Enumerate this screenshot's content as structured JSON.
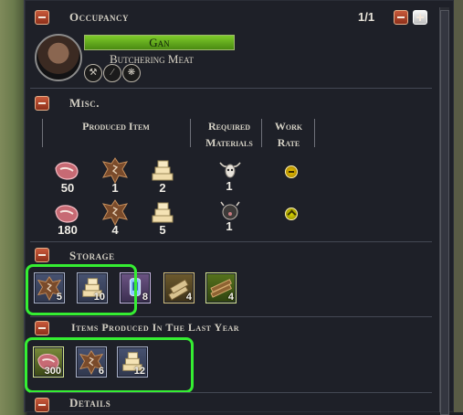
{
  "occupancy": {
    "title": "Occupancy",
    "counter": "1/1",
    "worker_name": "Gan",
    "activity": "Butchering Meat"
  },
  "misc": {
    "title": "Misc.",
    "columns": [
      "Produced Item",
      "Required Materials",
      "Work Rate"
    ],
    "recipes": [
      {
        "produced": [
          "50",
          "1",
          "2"
        ],
        "materials": [
          "1"
        ],
        "rate": "down"
      },
      {
        "produced": [
          "180",
          "4",
          "5"
        ],
        "materials": [
          "1"
        ],
        "rate": "up"
      }
    ]
  },
  "storage": {
    "title": "Storage",
    "items": [
      {
        "icon": "hide-icon",
        "count": "5"
      },
      {
        "icon": "bone-stack-icon",
        "count": "10"
      },
      {
        "icon": "blue-tool-icon",
        "count": "8"
      },
      {
        "icon": "wood-log-icon",
        "count": "4"
      },
      {
        "icon": "firewood-icon",
        "count": "4"
      }
    ]
  },
  "produced_last_year": {
    "title": "Items Produced In The Last Year",
    "items": [
      {
        "icon": "meat-icon",
        "count": "300"
      },
      {
        "icon": "hide-icon",
        "count": "6"
      },
      {
        "icon": "bone-stack-icon",
        "count": "12"
      }
    ]
  },
  "details": {
    "title": "Details"
  }
}
